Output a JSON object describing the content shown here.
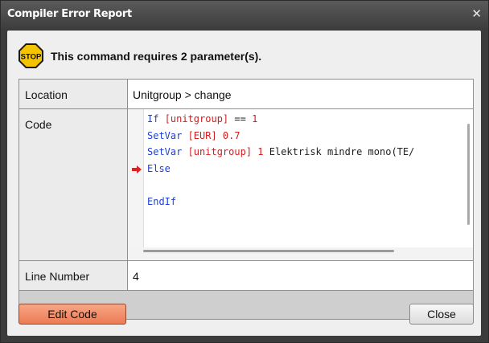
{
  "window": {
    "title": "Compiler Error Report",
    "close_glyph": "✕",
    "close_icon": "close-icon"
  },
  "message": {
    "icon": "stop-sign-icon",
    "stop_text": "STOP",
    "text": "This command requires 2 parameter(s)."
  },
  "details": {
    "location_label": "Location",
    "location_value": "Unitgroup > change",
    "code_label": "Code",
    "line_number_label": "Line Number",
    "line_number_value": "4"
  },
  "code": {
    "error_marker_icon": "red-arrow-icon",
    "lines": [
      {
        "tokens": [
          {
            "t": "If ",
            "c": "kw"
          },
          {
            "t": "[unitgroup]",
            "c": "var"
          },
          {
            "t": " == ",
            "c": "txt"
          },
          {
            "t": "1",
            "c": "num"
          }
        ],
        "marker": false
      },
      {
        "tokens": [
          {
            "t": "SetVar ",
            "c": "kw"
          },
          {
            "t": "[EUR]",
            "c": "var"
          },
          {
            "t": " 0.7",
            "c": "num"
          }
        ],
        "marker": false
      },
      {
        "tokens": [
          {
            "t": "SetVar ",
            "c": "kw"
          },
          {
            "t": "[unitgroup]",
            "c": "var"
          },
          {
            "t": " 1",
            "c": "num"
          },
          {
            "t": " Elektrisk mindre mono(TE/",
            "c": "txt"
          }
        ],
        "marker": false
      },
      {
        "tokens": [
          {
            "t": "Else",
            "c": "kw"
          }
        ],
        "marker": true
      },
      {
        "tokens": [],
        "marker": false
      },
      {
        "tokens": [
          {
            "t": "EndIf",
            "c": "kw"
          }
        ],
        "marker": false
      }
    ]
  },
  "buttons": {
    "edit_code": "Edit Code",
    "close": "Close"
  },
  "colors": {
    "keyword": "#1f3fd6",
    "variable": "#cc2020",
    "error_marker": "#e02020",
    "edit_button": "#ec7b55",
    "stop_sign": "#f5c400"
  }
}
